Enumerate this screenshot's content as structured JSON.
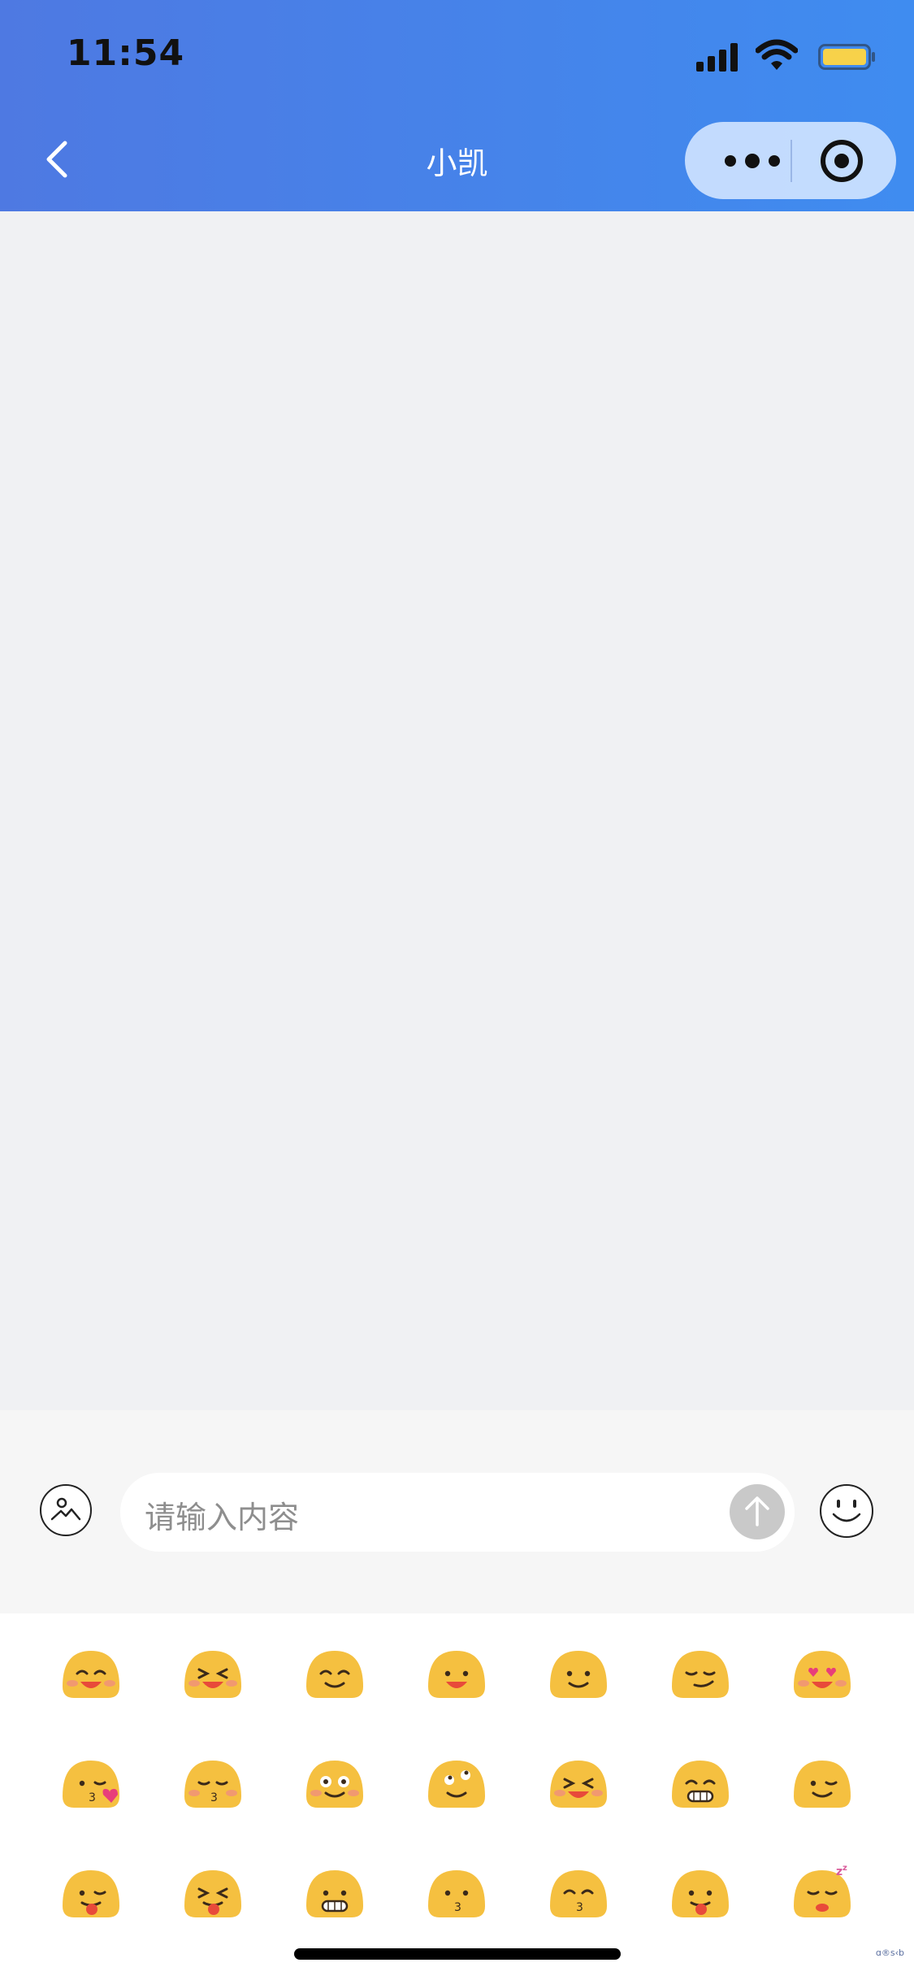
{
  "status_bar": {
    "time": "11:54"
  },
  "nav": {
    "title": "小凯"
  },
  "input": {
    "placeholder": "请输入内容"
  },
  "emojis": [
    [
      "grin-blush",
      "laugh-squint",
      "smile-closed",
      "open-smile",
      "plain-smile",
      "smirk",
      "heart-eyes"
    ],
    [
      "kiss-heart",
      "kiss-blush",
      "flushed",
      "rolling-eyes",
      "laugh-blush",
      "grimace-grin",
      "wink"
    ],
    [
      "tongue-wink",
      "tongue-squint",
      "big-grin",
      "kiss",
      "kiss-closed",
      "tongue",
      "sleepy"
    ]
  ],
  "watermark": "ɑ®s‹b",
  "colors": {
    "header_start": "#4e79e2",
    "header_end": "#3f8cf0",
    "emoji_face": "#f5c040",
    "blush": "#f08f7c"
  }
}
